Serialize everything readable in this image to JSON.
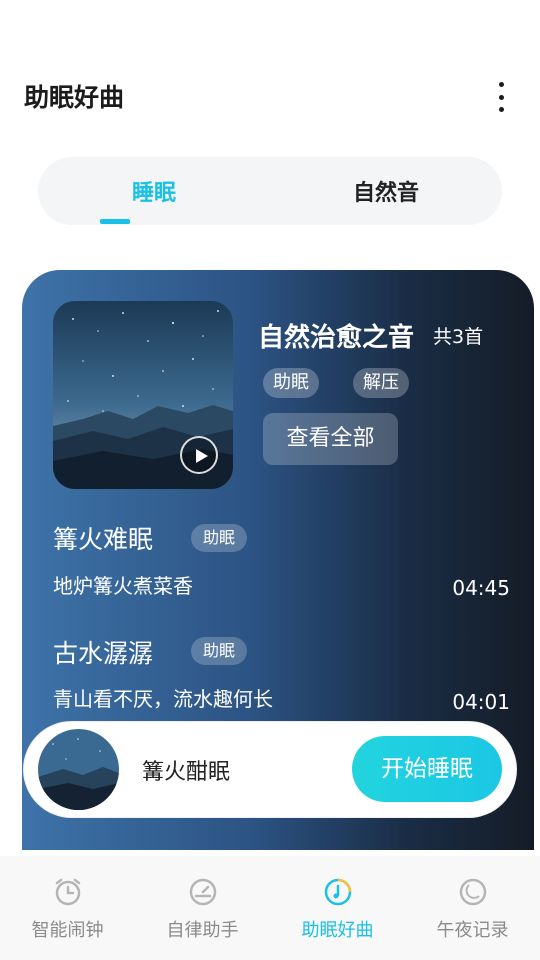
{
  "header": {
    "title": "助眠好曲",
    "more_icon": "more-vertical-icon"
  },
  "tabs": [
    {
      "label": "睡眠",
      "active": true
    },
    {
      "label": "自然音",
      "active": false
    }
  ],
  "accent_color": "#19c0e8",
  "album": {
    "title": "自然治愈之音",
    "count": "共3首",
    "tags": [
      "助眠",
      "解压"
    ],
    "view_all_label": "查看全部",
    "play_icon": "play-icon"
  },
  "songs": [
    {
      "title": "篝火难眠",
      "tag": "助眠",
      "subtitle": "地炉篝火煮菜香",
      "duration": "04:45"
    },
    {
      "title": "古水潺潺",
      "tag": "助眠",
      "subtitle": "青山看不厌，流水趣何长",
      "duration": "04:01"
    },
    {
      "title": "",
      "tag": "",
      "subtitle": "",
      "duration": ""
    }
  ],
  "player": {
    "title": "篝火酣眠",
    "start_label": "开始睡眠"
  },
  "bottom_nav": [
    {
      "label": "智能闹钟",
      "icon": "alarm-clock-icon",
      "active": false
    },
    {
      "label": "自律助手",
      "icon": "gauge-icon",
      "active": false
    },
    {
      "label": "助眠好曲",
      "icon": "music-disc-icon",
      "active": true
    },
    {
      "label": "午夜记录",
      "icon": "moon-clock-icon",
      "active": false
    }
  ]
}
